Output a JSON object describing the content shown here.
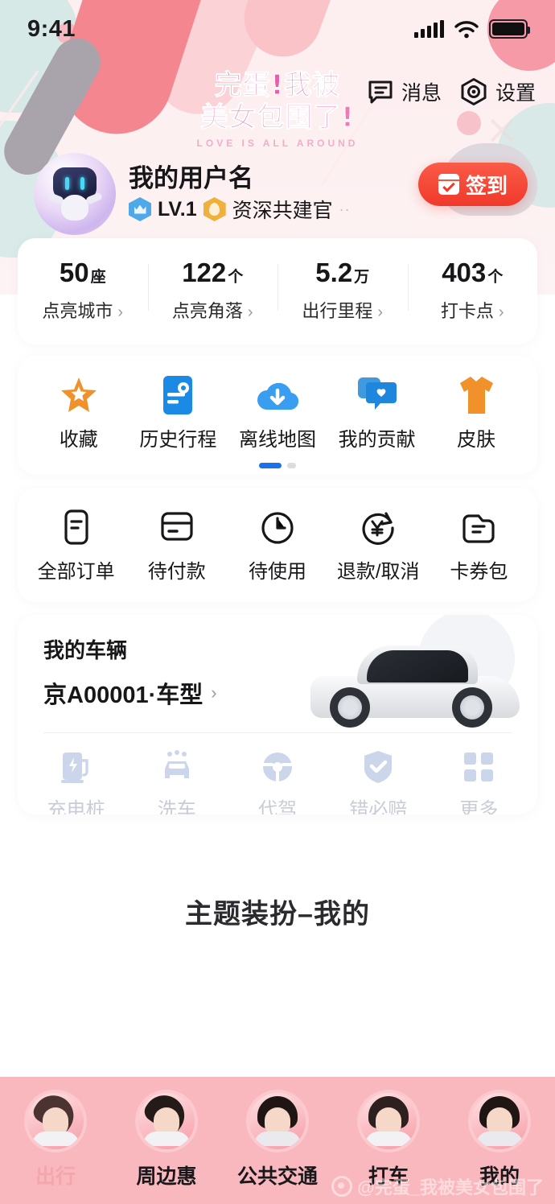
{
  "status_bar": {
    "time": "9:41",
    "signal_icon": "cellular-signal-icon",
    "wifi_icon": "wifi-icon",
    "battery_icon": "battery-icon"
  },
  "banner": {
    "line1": "完蛋!我被",
    "line2": "美女包围了!",
    "subtitle": "LOVE IS ALL AROUND",
    "actions": [
      {
        "label": "消息",
        "icon": "message-icon"
      },
      {
        "label": "设置",
        "icon": "settings-icon"
      }
    ]
  },
  "profile": {
    "avatar_icon": "robot-avatar",
    "username": "我的用户名",
    "level": "LV.1",
    "level_icon": "crown-badge-icon",
    "role": "资深共建官",
    "role_icon": "flame-badge-icon",
    "role_suffix": "··",
    "signin_label": "签到",
    "signin_icon": "calendar-check-icon"
  },
  "stats": [
    {
      "value": "50",
      "unit": "座",
      "label": "点亮城市",
      "chevron": "›"
    },
    {
      "value": "122",
      "unit": "个",
      "label": "点亮角落",
      "chevron": "›"
    },
    {
      "value": "5.2",
      "unit": "万",
      "label": "出行里程",
      "chevron": "›"
    },
    {
      "value": "403",
      "unit": "个",
      "label": "打卡点",
      "chevron": "›"
    }
  ],
  "tools": {
    "items": [
      {
        "label": "收藏",
        "icon": "star-favorite-icon",
        "color": "#f0912c"
      },
      {
        "label": "历史行程",
        "icon": "trip-history-icon",
        "color": "#1a8ae5"
      },
      {
        "label": "离线地图",
        "icon": "offline-map-download-icon",
        "color": "#3a9ef0"
      },
      {
        "label": "我的贡献",
        "icon": "contribution-chat-icon",
        "color": "#1e86dd"
      },
      {
        "label": "皮肤",
        "icon": "tshirt-skin-icon",
        "color": "#f0912c"
      }
    ],
    "pagination": {
      "total": 2,
      "active": 1
    }
  },
  "orders": {
    "items": [
      {
        "label": "全部订单",
        "icon": "all-orders-icon"
      },
      {
        "label": "待付款",
        "icon": "pending-payment-icon"
      },
      {
        "label": "待使用",
        "icon": "pending-use-clock-icon"
      },
      {
        "label": "退款/取消",
        "icon": "refund-cancel-icon"
      },
      {
        "label": "卡券包",
        "icon": "coupon-wallet-icon"
      }
    ]
  },
  "vehicle": {
    "title": "我的车辆",
    "plate": "京A00001·车型",
    "chevron": "›",
    "car_image": "white-car-illustration",
    "services": [
      {
        "label": "充电桩",
        "icon": "charging-station-icon"
      },
      {
        "label": "洗车",
        "icon": "car-wash-icon"
      },
      {
        "label": "代驾",
        "icon": "designated-driver-icon"
      },
      {
        "label": "错必赔",
        "icon": "guarantee-shield-icon"
      },
      {
        "label": "更多",
        "icon": "more-grid-icon"
      }
    ]
  },
  "theme_section": {
    "label": "主题装扮–我的"
  },
  "tabbar": {
    "items": [
      {
        "label": "出行",
        "icon": "avatar-tab-travel",
        "active": true
      },
      {
        "label": "周边惠",
        "icon": "avatar-tab-nearby",
        "active": false
      },
      {
        "label": "公共交通",
        "icon": "avatar-tab-transit",
        "active": false
      },
      {
        "label": "打车",
        "icon": "avatar-tab-taxi",
        "active": false
      },
      {
        "label": "我的",
        "icon": "avatar-tab-mine",
        "active": false
      }
    ]
  },
  "watermark": {
    "logo_icon": "weibo-logo-icon",
    "text": "@完蛋_我被美女包围了"
  },
  "colors": {
    "header_pink": "#fdeef0",
    "accent_red": "#f0392a",
    "accent_blue": "#1b72e8",
    "tabbar_pink": "#f9b8bd",
    "brand_magenta": "#e85fa8"
  }
}
